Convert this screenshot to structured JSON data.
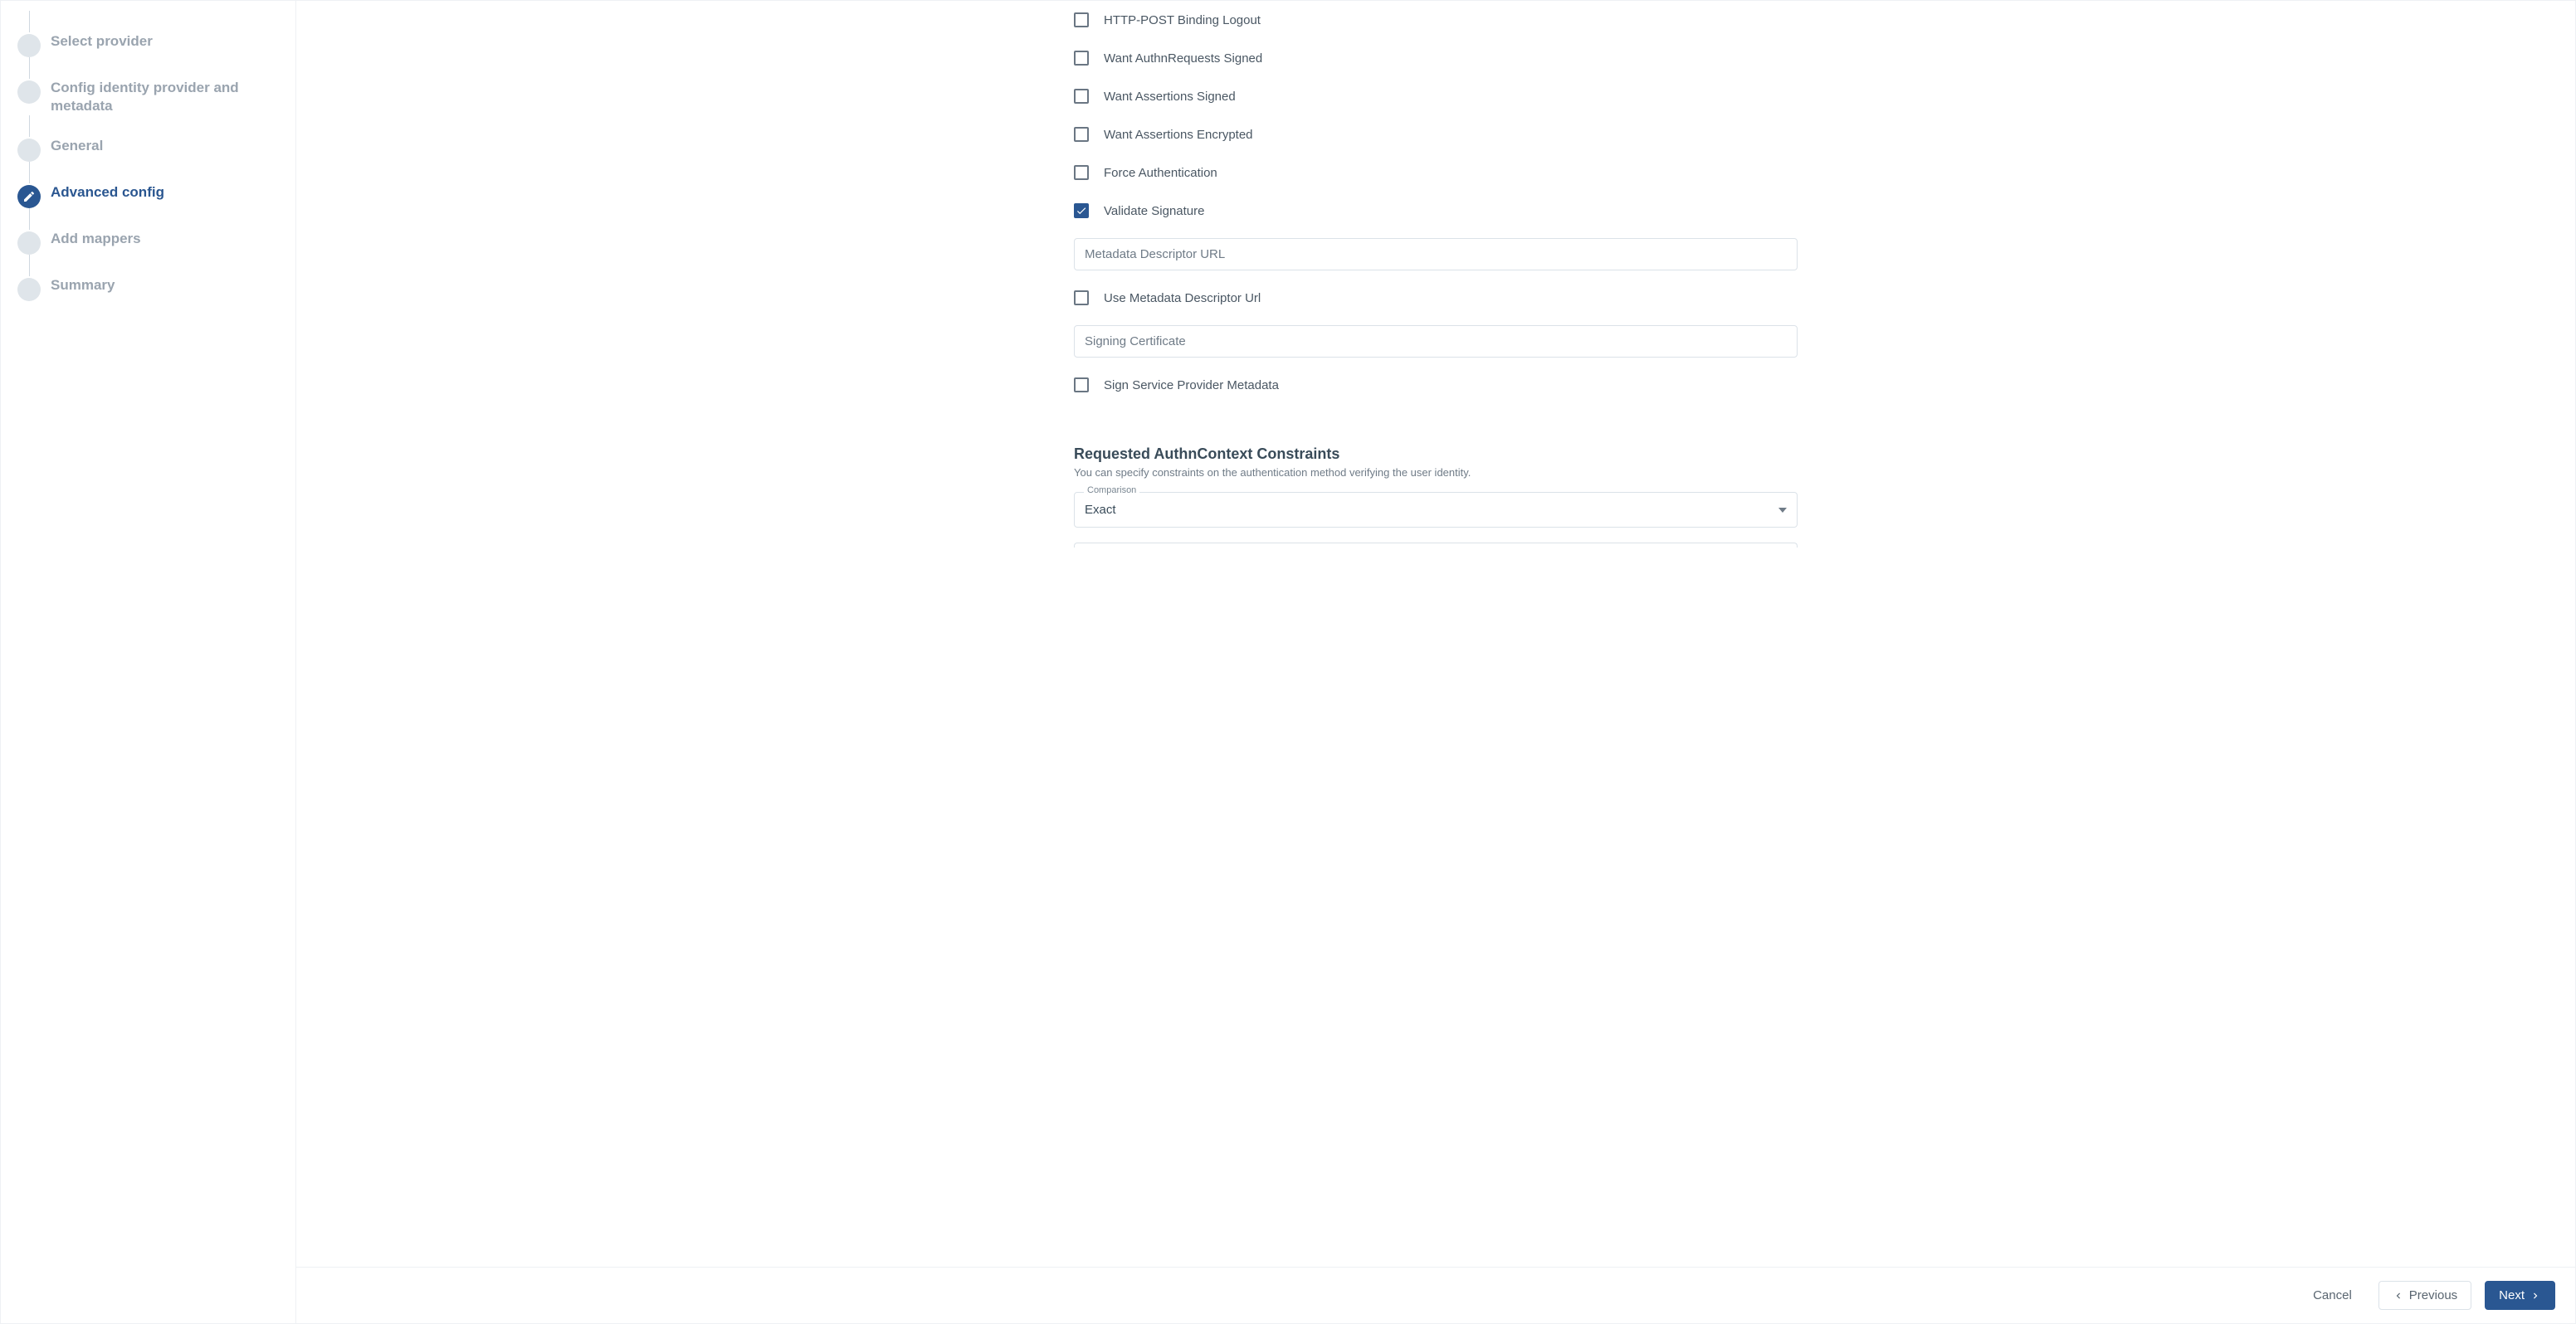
{
  "sidebar": {
    "steps": [
      {
        "label": "Select provider",
        "active": false
      },
      {
        "label": "Config identity provider and metadata",
        "active": false
      },
      {
        "label": "General",
        "active": false
      },
      {
        "label": "Advanced config",
        "active": true
      },
      {
        "label": "Add mappers",
        "active": false
      },
      {
        "label": "Summary",
        "active": false
      }
    ]
  },
  "form": {
    "checkboxes": {
      "http_post_binding_logout": {
        "label": "HTTP-POST Binding Logout",
        "checked": false
      },
      "want_authn_requests_signed": {
        "label": "Want AuthnRequests Signed",
        "checked": false
      },
      "want_assertions_signed": {
        "label": "Want Assertions Signed",
        "checked": false
      },
      "want_assertions_encrypted": {
        "label": "Want Assertions Encrypted",
        "checked": false
      },
      "force_authentication": {
        "label": "Force Authentication",
        "checked": false
      },
      "validate_signature": {
        "label": "Validate Signature",
        "checked": true
      },
      "use_metadata_descriptor_url": {
        "label": "Use Metadata Descriptor Url",
        "checked": false
      },
      "sign_service_provider_metadata": {
        "label": "Sign Service Provider Metadata",
        "checked": false
      }
    },
    "inputs": {
      "metadata_descriptor_url": {
        "placeholder": "Metadata Descriptor URL",
        "value": ""
      },
      "signing_certificate": {
        "placeholder": "Signing Certificate",
        "value": ""
      }
    },
    "section": {
      "title": "Requested AuthnContext Constraints",
      "desc": "You can specify constraints on the authentication method verifying the user identity."
    },
    "comparison": {
      "label": "Comparison",
      "value": "Exact"
    }
  },
  "footer": {
    "cancel": "Cancel",
    "previous": "Previous",
    "next": "Next"
  }
}
